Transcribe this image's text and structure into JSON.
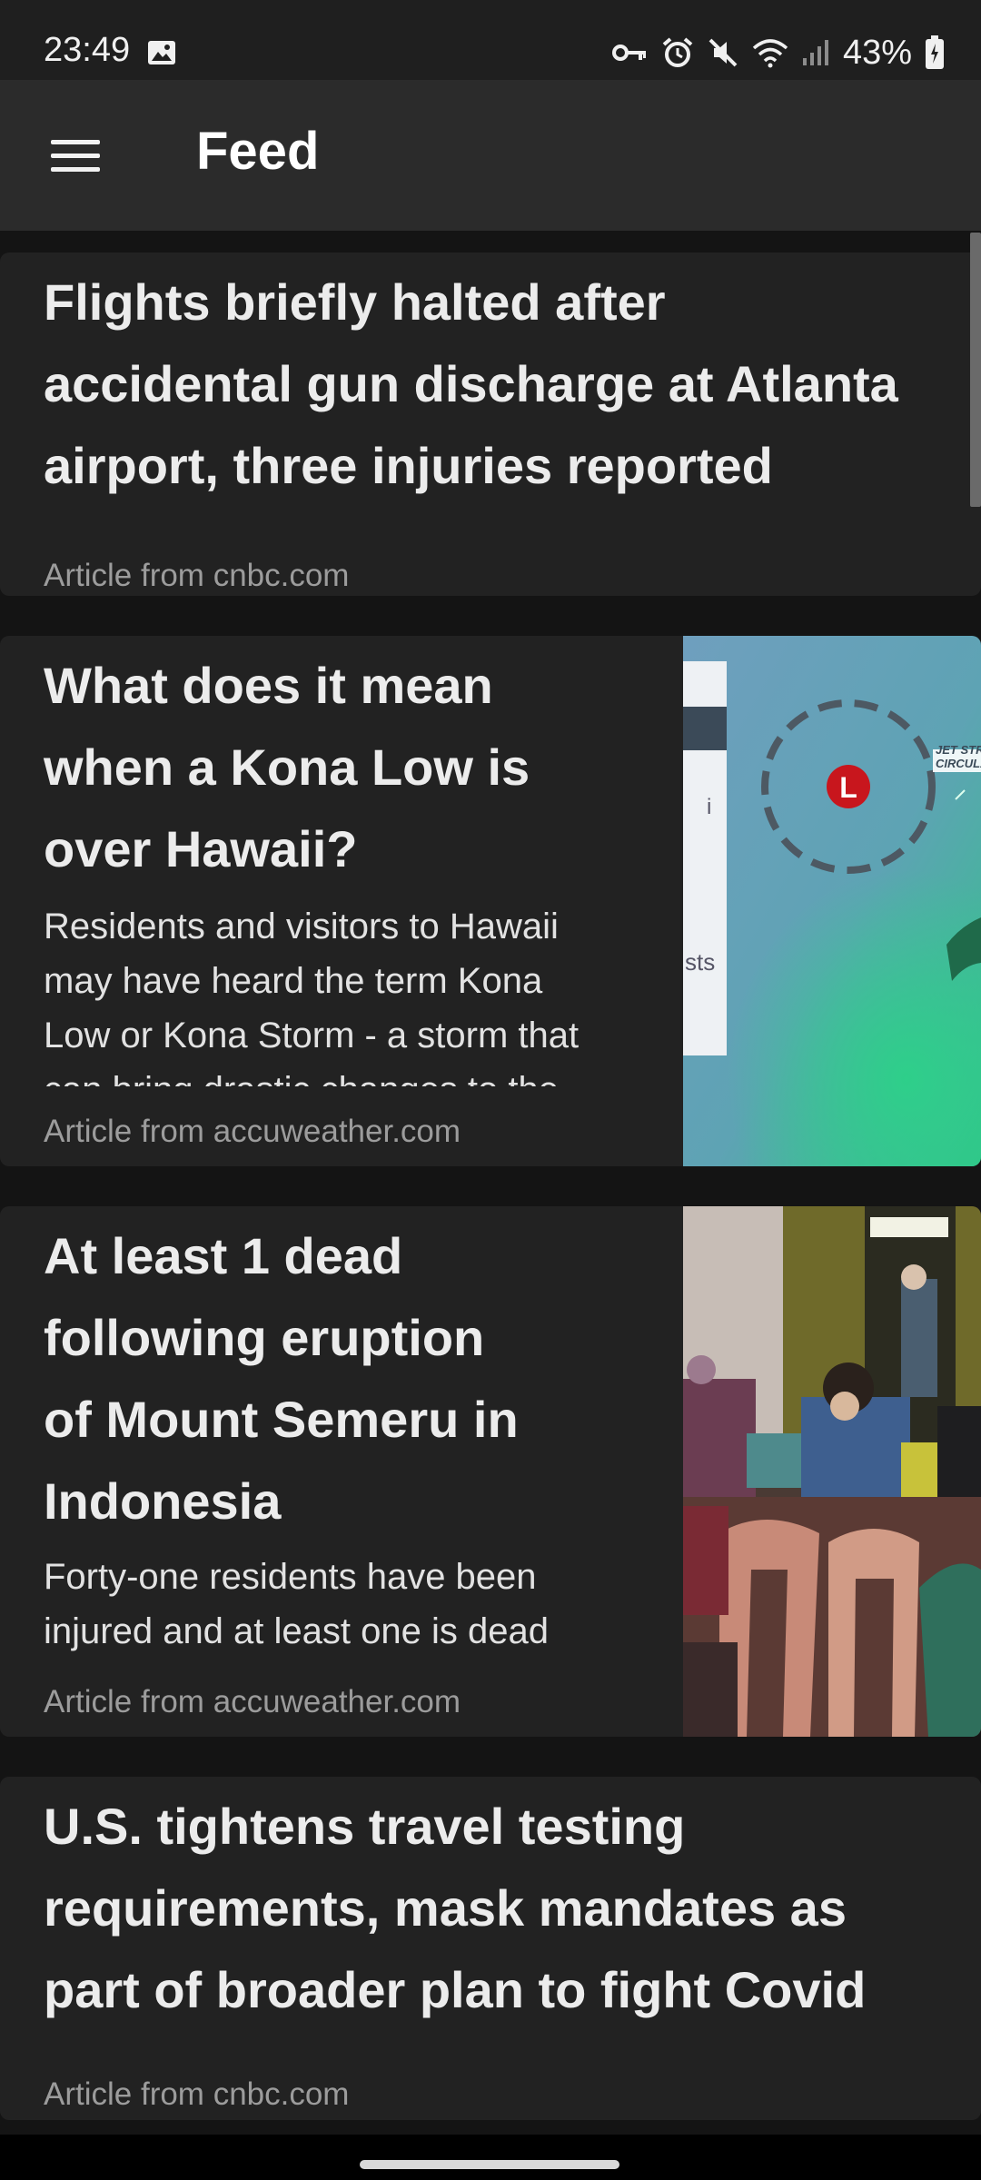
{
  "status_bar": {
    "time": "23:49",
    "battery": "43%",
    "icons": [
      "gallery-icon",
      "vpn-key-icon",
      "alarm-icon",
      "mute-icon",
      "wifi-icon",
      "signal-icon",
      "battery-icon"
    ]
  },
  "app_bar": {
    "title": "Feed",
    "menu_icon": "hamburger-menu-icon"
  },
  "feed": {
    "items": [
      {
        "title": "Flights briefly halted after accidental gun discharge at Atlanta airport, three injuries reported",
        "title_lines": [
          "Flights briefly halted after",
          "accidental gun discharge at Atlanta",
          "airport, three injuries reported"
        ],
        "source": "Article from cnbc.com"
      },
      {
        "title": "What does it mean when a Kona Low is over Hawaii?",
        "title_lines": [
          "What does it mean",
          "when a Kona Low is",
          "over Hawaii?"
        ],
        "summary_lines": [
          "Residents and visitors to Hawaii",
          "may have heard the term Kona",
          "Low or Kona Storm - a storm that",
          "can bring drastic changes to the"
        ],
        "source": "Article from accuweather.com",
        "image": {
          "kind": "weather-map",
          "marker_label": "L",
          "text_fragments": [
            "JET STRE",
            "CIRCULAT",
            "i",
            "sts"
          ]
        }
      },
      {
        "title": "At least 1 dead following eruption of Mount Semeru in Indonesia",
        "title_lines": [
          "At least 1 dead",
          "following eruption",
          "of Mount Semeru in",
          "Indonesia"
        ],
        "summary_lines": [
          "Forty-one residents have been",
          "injured and at least one is dead"
        ],
        "source": "Article from accuweather.com",
        "image": {
          "kind": "photo-evacuation-shelter"
        }
      },
      {
        "title": "U.S. tightens travel testing requirements, mask mandates as part of broader plan to fight Covid",
        "title_lines": [
          "U.S. tightens travel testing",
          "requirements, mask mandates as",
          "part of broader plan to fight Covid"
        ],
        "source": "Article from cnbc.com"
      }
    ]
  },
  "colors": {
    "background": "#141414",
    "card": "#222222",
    "app_bar": "#2b2b2b",
    "source_text": "#9c9c9c",
    "kona_marker": "#c8161d"
  }
}
